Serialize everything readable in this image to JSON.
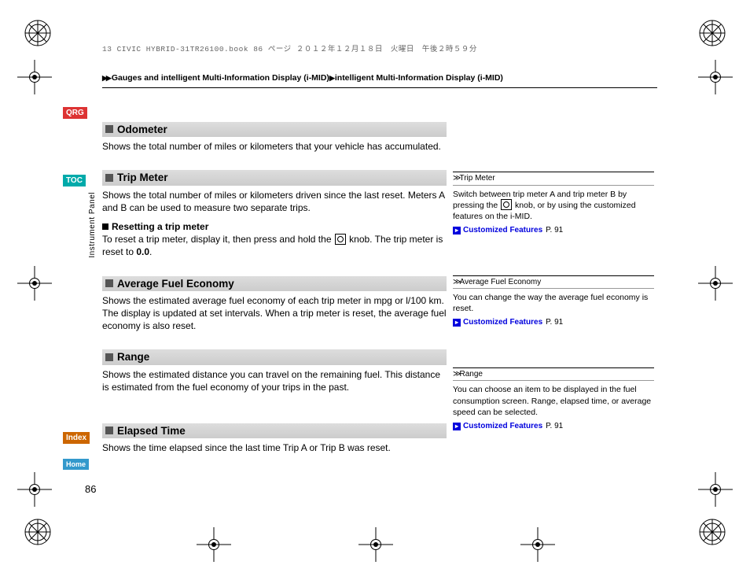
{
  "header": "13 CIVIC HYBRID-31TR26100.book  86 ページ  ２０１２年１２月１８日　火曜日　午後２時５９分",
  "breadcrumb": {
    "seg1": "Gauges and intelligent Multi-Information Display (i-MID)",
    "seg2": "intelligent Multi-Information Display (i-MID)"
  },
  "nav": {
    "qrg": "QRG",
    "toc": "TOC",
    "index": "Index",
    "home": "Home"
  },
  "side_label": "Instrument Panel",
  "page_number": "86",
  "sections": {
    "odometer": {
      "title": "Odometer",
      "body": "Shows the total number of miles or kilometers that your vehicle has accumulated."
    },
    "trip": {
      "title": "Trip Meter",
      "body": "Shows the total number of miles or kilometers driven since the last reset. Meters A and B can be used to measure two separate trips.",
      "subhead": "Resetting a trip meter",
      "sub_a": "To reset a trip meter, display it, then press and hold the ",
      "sub_b": " knob. The trip meter is reset to ",
      "sub_c": "0.0",
      "sub_d": "."
    },
    "fuel": {
      "title": "Average Fuel Economy",
      "body": "Shows the estimated average fuel economy of each trip meter in mpg or l/100 km. The display is updated at set intervals. When a trip meter is reset, the average fuel economy is also reset."
    },
    "range": {
      "title": "Range",
      "body": "Shows the estimated distance you can travel on the remaining fuel. This distance is estimated from the fuel economy of your trips in the past."
    },
    "elapsed": {
      "title": "Elapsed Time",
      "body": "Shows the time elapsed since the last time Trip A or Trip B was reset."
    }
  },
  "sidebar": {
    "trip": {
      "head": "Trip Meter",
      "body_a": "Switch between trip meter A and trip meter B by pressing the ",
      "body_b": " knob, or by using the customized features on the i-MID.",
      "link": "Customized Features",
      "page": "P. 91"
    },
    "fuel": {
      "head": "Average Fuel Economy",
      "body": "You can change the way the average fuel economy is reset.",
      "link": "Customized Features",
      "page": "P. 91"
    },
    "range": {
      "head": "Range",
      "body": "You can choose an item to be displayed in the fuel consumption screen. Range, elapsed time, or average speed can be selected.",
      "link": "Customized Features",
      "page": "P. 91"
    }
  }
}
